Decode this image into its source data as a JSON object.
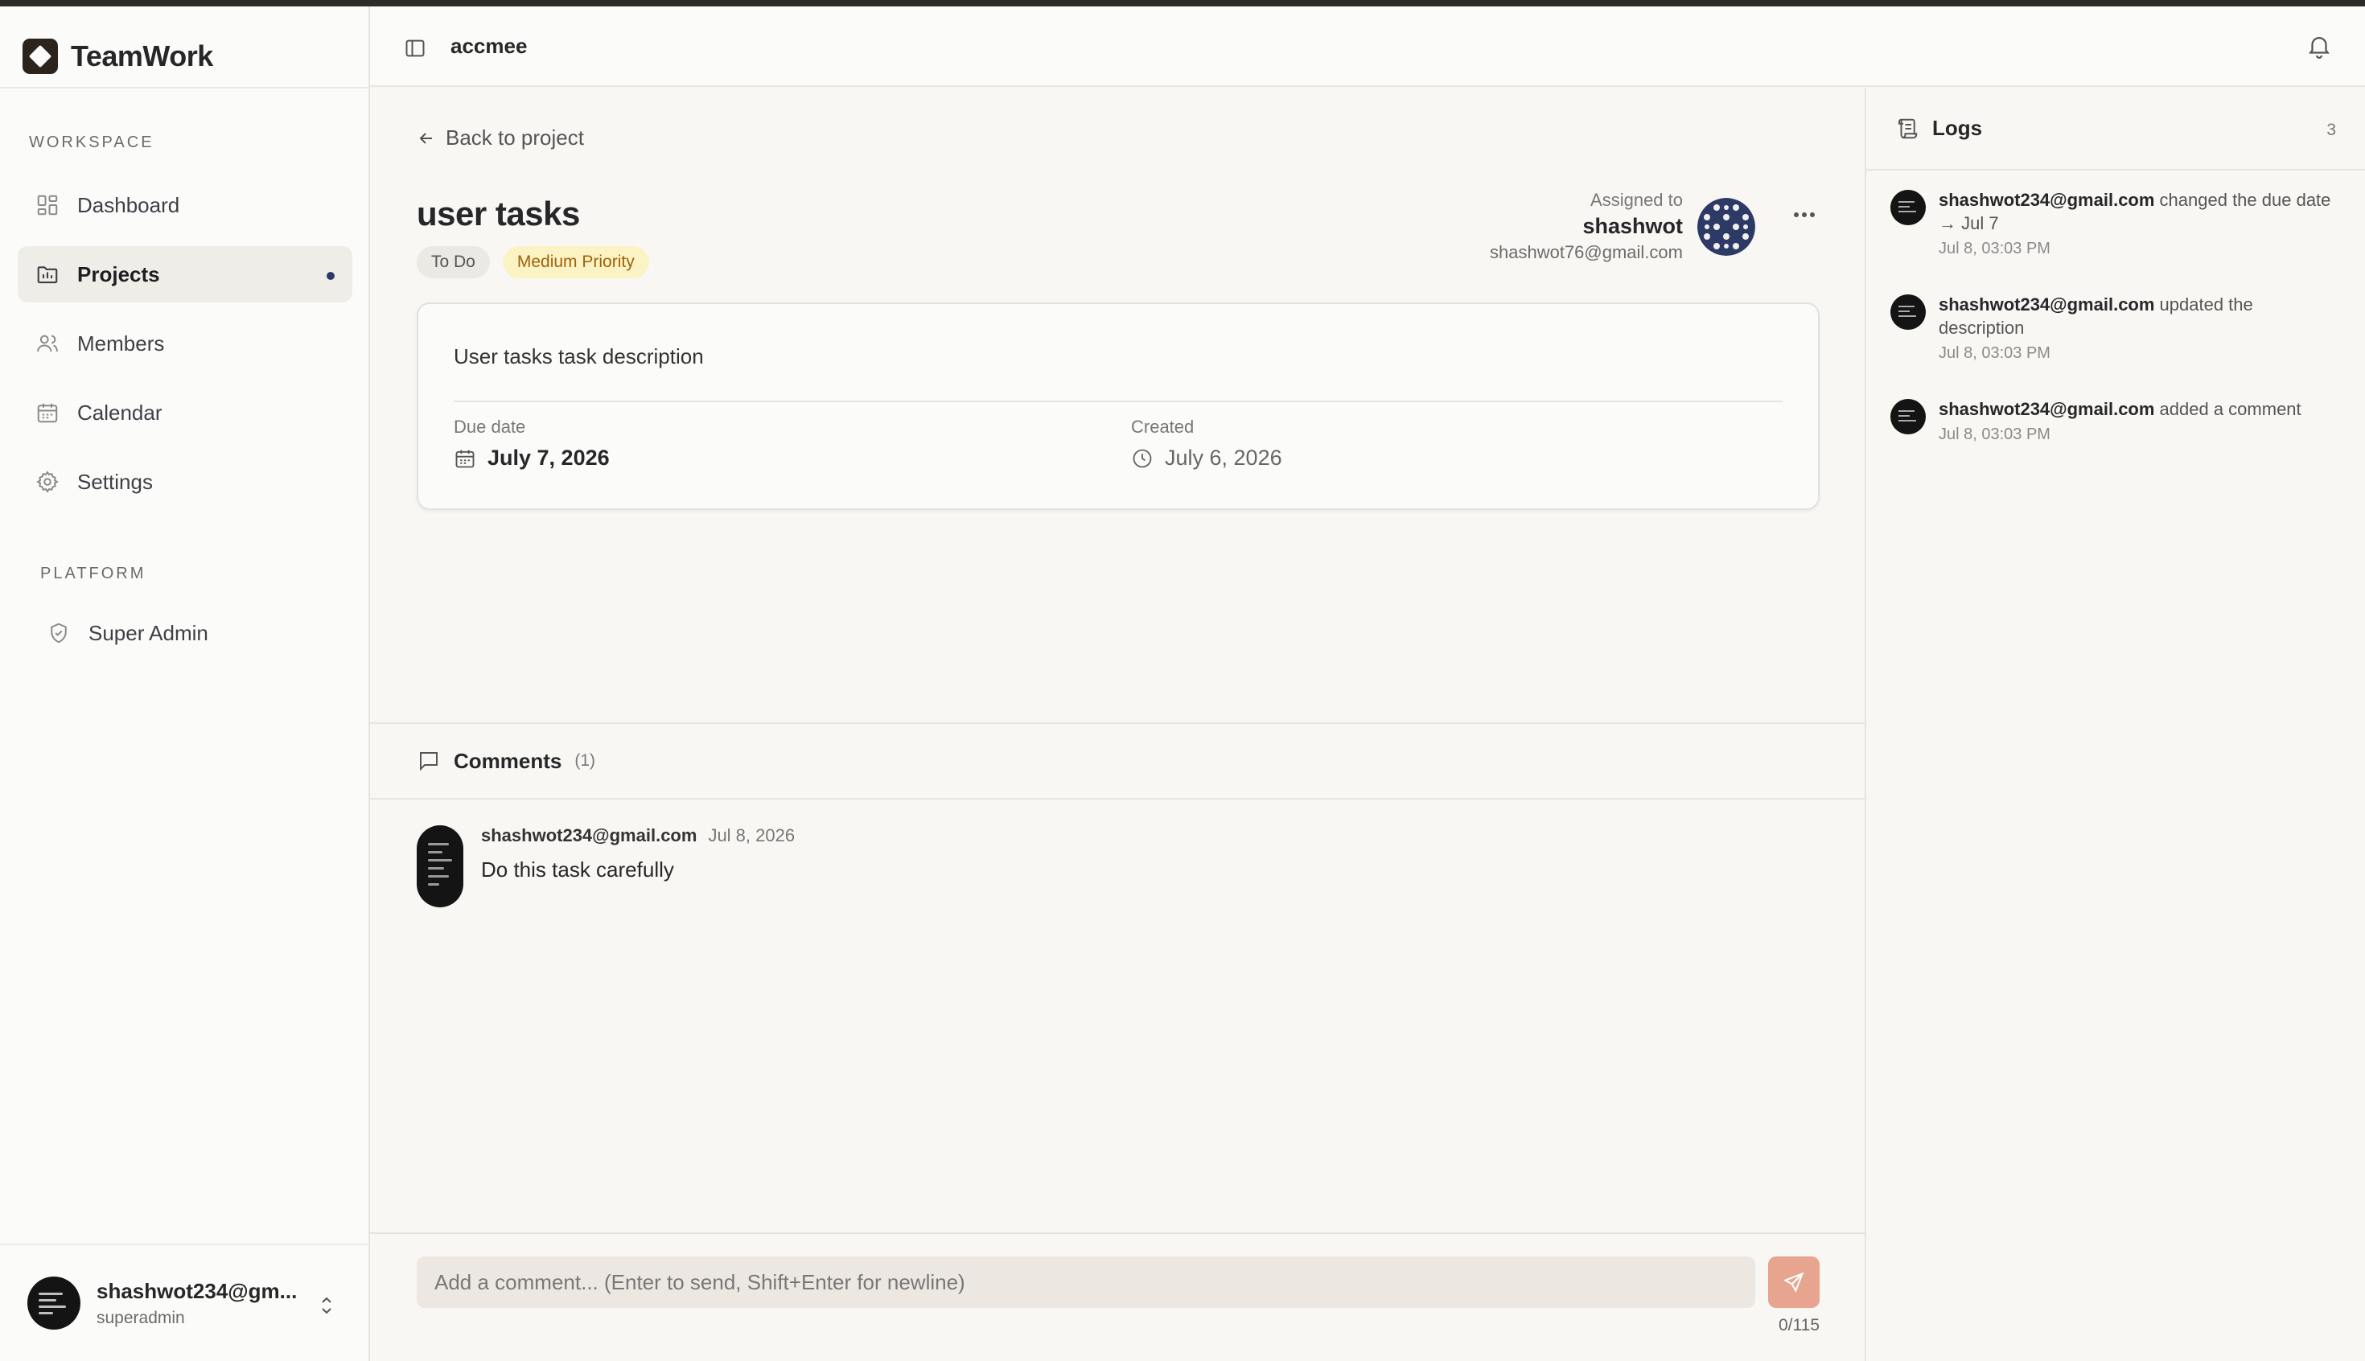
{
  "brand": {
    "name": "TeamWork"
  },
  "sidebar": {
    "workspace_label": "WORKSPACE",
    "platform_label": "PLATFORM",
    "items": [
      {
        "label": "Dashboard",
        "icon": "dashboard-icon"
      },
      {
        "label": "Projects",
        "icon": "projects-icon",
        "active": true
      },
      {
        "label": "Members",
        "icon": "members-icon"
      },
      {
        "label": "Calendar",
        "icon": "calendar-icon"
      },
      {
        "label": "Settings",
        "icon": "settings-icon"
      }
    ],
    "platform_items": [
      {
        "label": "Super Admin",
        "icon": "shield-icon"
      }
    ],
    "user": {
      "name": "shashwot234@gm...",
      "role": "superadmin"
    }
  },
  "header": {
    "org": "accmee"
  },
  "task": {
    "back_label": "Back to project",
    "title": "user tasks",
    "status": "To Do",
    "priority": "Medium Priority",
    "assigned_label": "Assigned to",
    "assignee_name": "shashwot",
    "assignee_email": "shashwot76@gmail.com",
    "description": "User tasks task description",
    "due_label": "Due date",
    "due_value": "July 7, 2026",
    "created_label": "Created",
    "created_value": "July 6, 2026"
  },
  "comments": {
    "title": "Comments",
    "count": "(1)",
    "items": [
      {
        "author": "shashwot234@gmail.com",
        "date": "Jul 8, 2026",
        "body": "Do this task carefully"
      }
    ],
    "placeholder": "Add a comment... (Enter to send, Shift+Enter for newline)",
    "counter": "0/115"
  },
  "logs": {
    "title": "Logs",
    "count": "3",
    "items": [
      {
        "who": "shashwot234@gmail.com",
        "action": " changed the due date → Jul 7",
        "time": "Jul 8, 03:03 PM"
      },
      {
        "who": "shashwot234@gmail.com",
        "action": " updated the description",
        "time": "Jul 8, 03:03 PM"
      },
      {
        "who": "shashwot234@gmail.com",
        "action": " added a comment",
        "time": "Jul 8, 03:03 PM"
      }
    ]
  },
  "colors": {
    "accent_dot": "#2d3a66",
    "priority_bg": "#fcf3c5",
    "priority_text": "#a16207",
    "send_button": "#e7a48f"
  }
}
